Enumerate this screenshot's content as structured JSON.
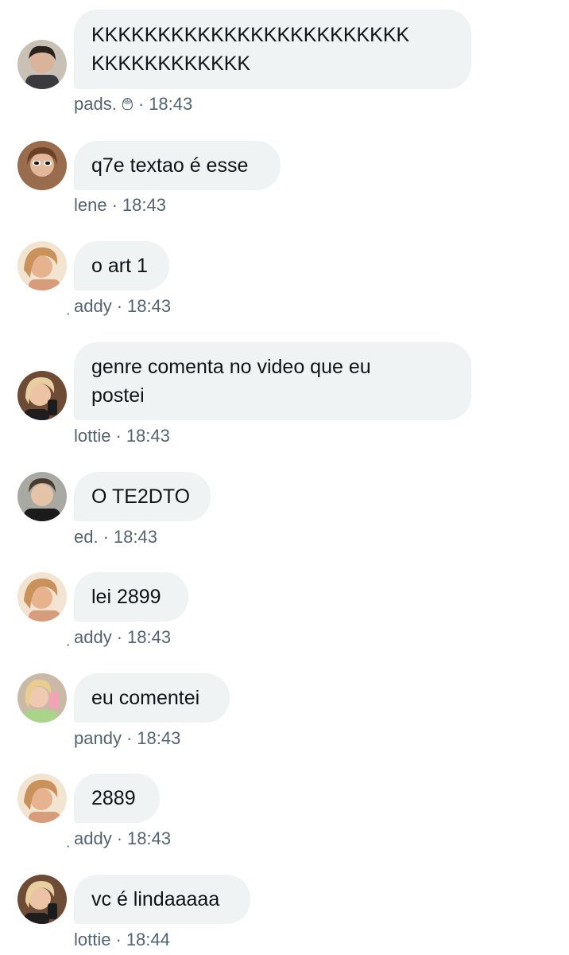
{
  "messages": [
    {
      "avatar_icon": "avatar-dark-hair-icon",
      "text": "KKKKKKKKKKKKKKKKKKKKKKKK\nKKKKKKKKKKKK",
      "author": "pads. ࿉",
      "time": "18:43"
    },
    {
      "avatar_icon": "avatar-sunglasses-icon",
      "text": "q7e textao é esse",
      "author": "lene",
      "time": "18:43"
    },
    {
      "avatar_icon": "avatar-blonde-icon",
      "text": "o art 1",
      "author": "̣addy",
      "time": "18:43"
    },
    {
      "avatar_icon": "avatar-blonde-phone-icon",
      "text": "genre comenta no video que eu\npostei",
      "author": "lottie",
      "time": "18:43"
    },
    {
      "avatar_icon": "avatar-dark-hair-icon",
      "text": "O TE2DTO",
      "author": "ed.",
      "time": "18:43"
    },
    {
      "avatar_icon": "avatar-blonde-icon",
      "text": "lei 2899",
      "author": "̣addy",
      "time": "18:43"
    },
    {
      "avatar_icon": "avatar-green-shirt-icon",
      "text": "eu comentei",
      "author": "pandy",
      "time": "18:43"
    },
    {
      "avatar_icon": "avatar-blonde-icon",
      "text": "2889",
      "author": "̣addy",
      "time": "18:43"
    },
    {
      "avatar_icon": "avatar-blonde-phone-icon",
      "text": "vc é lindaaaaa",
      "author": "lottie",
      "time": "18:44"
    }
  ],
  "colors": {
    "bubble_bg": "#eff3f4",
    "text": "#0f1419",
    "meta": "#536471"
  }
}
